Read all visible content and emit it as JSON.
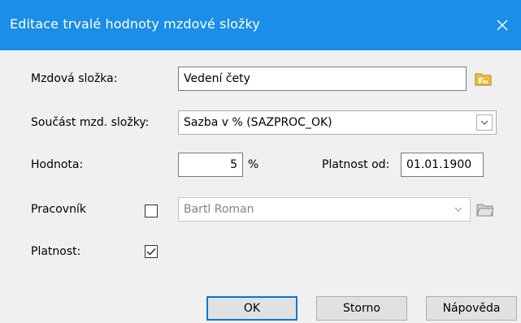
{
  "window": {
    "title": "Editace trvalé hodnoty mzdové složky",
    "close_glyph": "✕"
  },
  "form": {
    "mzdova_slozka": {
      "label": "Mzdová složka:",
      "value": "Vedení čety"
    },
    "soucast": {
      "label": "Součást mzd. složky:",
      "value": "Sazba v % (SAZPROC_OK)"
    },
    "hodnota": {
      "label": "Hodnota:",
      "value": "5",
      "unit": "%"
    },
    "platnost_od": {
      "label": "Platnost od:",
      "value": "01.01.1900"
    },
    "pracovnik": {
      "label": "Pracovník",
      "checked": false,
      "value": "Bartl Roman",
      "disabled": true
    },
    "platnost": {
      "label": "Platnost:",
      "checked": true
    }
  },
  "buttons": {
    "ok": "OK",
    "storno": "Storno",
    "napoveda": "Nápověda"
  },
  "colors": {
    "titlebar": "#1a8ee8",
    "accent": "#0078d7",
    "disabled_text": "#838383"
  },
  "icons": {
    "close": "close-icon",
    "folder": "folder-icon",
    "dropdown": "chevron-down-icon",
    "check": "checkmark-icon"
  }
}
